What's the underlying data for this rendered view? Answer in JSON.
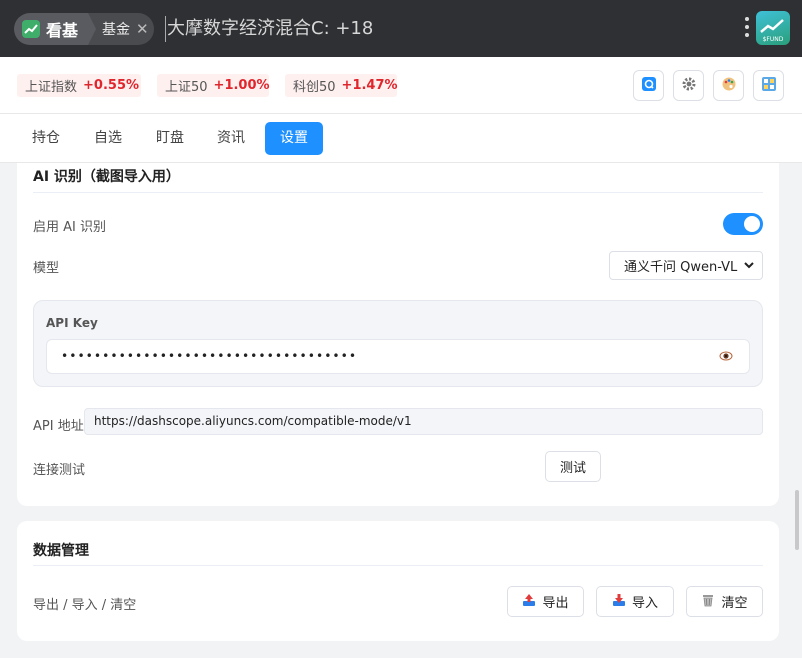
{
  "window": {
    "app_tab": "看基",
    "sub_tab": "基金",
    "title": "大摩数字经济混合C: +18",
    "logo_text": "$FUND"
  },
  "indices": [
    {
      "name": "上证指数",
      "change": "+0.55%"
    },
    {
      "name": "上证50",
      "change": "+1.00%"
    },
    {
      "name": "科创50",
      "change": "+1.47%"
    }
  ],
  "nav": {
    "tabs": [
      "持仓",
      "自选",
      "盯盘",
      "资讯",
      "设置"
    ],
    "active": "设置"
  },
  "ai": {
    "section_title": "AI 识别（截图导入用）",
    "enable_label": "启用 AI 识别",
    "enabled": true,
    "model_label": "模型",
    "model_value": "通义千问 Qwen-VL",
    "api_key_title": "API Key",
    "api_key_masked": "••••••••••••••••••••••••••••••••••••",
    "api_url_label": "API 地址",
    "api_url_value": "https://dashscope.aliyuncs.com/compatible-mode/v1",
    "test_label": "连接测试",
    "test_button": "测试"
  },
  "data_mgmt": {
    "section_title": "数据管理",
    "row_label": "导出 / 导入 / 清空",
    "export_button": "导出",
    "import_button": "导入",
    "clear_button": "清空"
  },
  "colors": {
    "accent": "#1e90ff",
    "up": "#e0262d",
    "titlebar": "#2f3033"
  }
}
